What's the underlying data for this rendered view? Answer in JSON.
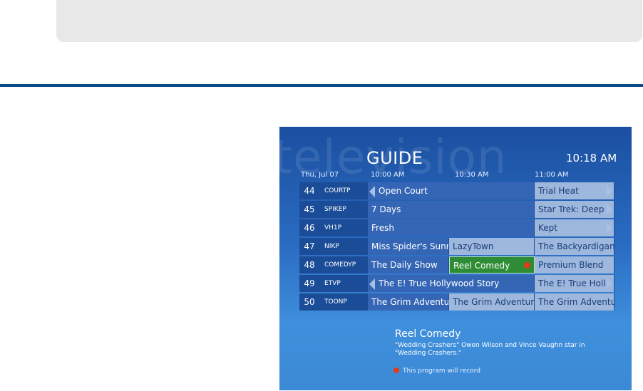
{
  "guide": {
    "watermark": "television",
    "title": "GUIDE",
    "clock": "10:18 AM",
    "date": "Thu, Jul 07",
    "times": [
      "10:00 AM",
      "10:30 AM",
      "11:00 AM"
    ],
    "rows": [
      {
        "num": "44",
        "name": "COURTP",
        "p1": "Open Court",
        "p3": "Trial Heat"
      },
      {
        "num": "45",
        "name": "SPIKEP",
        "p1": "7 Days",
        "p3": "Star Trek: Deep"
      },
      {
        "num": "46",
        "name": "VH1P",
        "p1": "Fresh",
        "p3": "Kept"
      },
      {
        "num": "47",
        "name": "NIKP",
        "p1": "Miss Spider's Sunny",
        "p2": "LazyTown",
        "p3": "The Backyardigans"
      },
      {
        "num": "48",
        "name": "COMEDYP",
        "p1": "The Daily Show",
        "p2": "Reel Comedy",
        "p3": "Premium Blend"
      },
      {
        "num": "49",
        "name": "ETVP",
        "p1": "The E! True Hollywood Story",
        "p3": "The E! True Holl"
      },
      {
        "num": "50",
        "name": "TOONP",
        "p1": "The Grim Adventures",
        "p2": "The Grim Adventures",
        "p3": "The Grim Adventures"
      }
    ],
    "info": {
      "title": "Reel Comedy",
      "description": "\"Wedding Crashers\"  Owen Wilson and Vince Vaughn star in \"Wedding Crashers.\"",
      "record_note": "This program will record"
    },
    "colors": {
      "accent": "#0b4a86",
      "selected": "#2e8d34",
      "record": "#e23a1a"
    }
  }
}
